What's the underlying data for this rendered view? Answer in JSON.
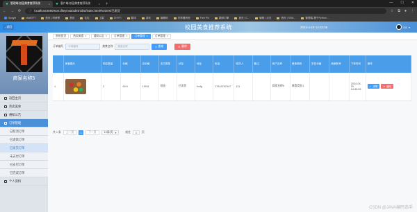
{
  "browser": {
    "tabs": [
      {
        "label": "管理端-校园美食推荐系统",
        "active": true
      },
      {
        "label": "客户端-校园美食推荐系统",
        "active": false
      }
    ],
    "url": "localhost:8080/ssm1fkeymsa/admin/dist/index.html#/orders/已发货",
    "bookmarks": [
      "Google",
      "chatGPT",
      "首页 | 科研帮",
      "首页",
      "论坛",
      "卫星",
      "CHYTI",
      "翻译",
      "游戏",
      "编辑码",
      "安排器其他",
      "Free Pic",
      "翻译引擎",
      "首页 | C...",
      "编程 | 点击",
      "首页 | SSM...",
      "管理端-基于Python..."
    ]
  },
  "header": {
    "back_label": "返回",
    "title": "校园美食推荐系统",
    "date": "2024-4-19 14:02:06",
    "user": "111"
  },
  "sidebar": {
    "shop_name": "商家名称5",
    "items": [
      {
        "label": "返回主页",
        "icon": "home-icon"
      },
      {
        "label": "热卖美食",
        "icon": "food-icon"
      },
      {
        "label": "通知公告",
        "icon": "bell-icon"
      },
      {
        "label": "订单管理",
        "icon": "order-icon"
      }
    ],
    "sub_items": [
      "已取消订单",
      "已退款订单",
      "已发货订单",
      "未支付订单",
      "已支付订单",
      "已完成订单"
    ],
    "current_sub": "已发货订单",
    "bottom_item": "个人资料"
  },
  "tabs": [
    "系统首页",
    "热卖美食",
    "通知公告",
    "订单管理",
    "订单管理",
    "订单管理"
  ],
  "search": {
    "order_label": "订单编号",
    "order_placeholder": "订单编号",
    "food_label": "美食名称",
    "food_placeholder": "美食名称",
    "query_label": "查询",
    "delete_label": "删除"
  },
  "table": {
    "headers": [
      "美食图片",
      "购买数量",
      "价格",
      "总价格",
      "支付类型",
      "状态",
      "地址",
      "电话",
      "收货人",
      "备注",
      "商户名称",
      "美食类别",
      "折扣价格",
      "商家账号",
      "下单时间",
      "操作"
    ],
    "rows": [
      {
        "index": "1",
        "quantity": "2",
        "price": "99.9",
        "total": "199.8",
        "payment": "现金",
        "status": "已发货",
        "address": "fxxfg",
        "phone": "17615787647",
        "receiver": "111",
        "note": "",
        "merchant": "商家名称5",
        "category": "美食类别1",
        "discount": "",
        "account": "",
        "time": "2024-04-19 14:40:05",
        "view_label": "详情",
        "delete_label": "删除"
      }
    ]
  },
  "pager": {
    "total": "共 1 条",
    "prev": "上一页",
    "page": "1",
    "next": "下一页",
    "page_size": "10条/页",
    "goto_label": "前往",
    "goto_value": "1",
    "page_suffix": "页"
  },
  "watermark": "CSDN @JAVA编码选手"
}
